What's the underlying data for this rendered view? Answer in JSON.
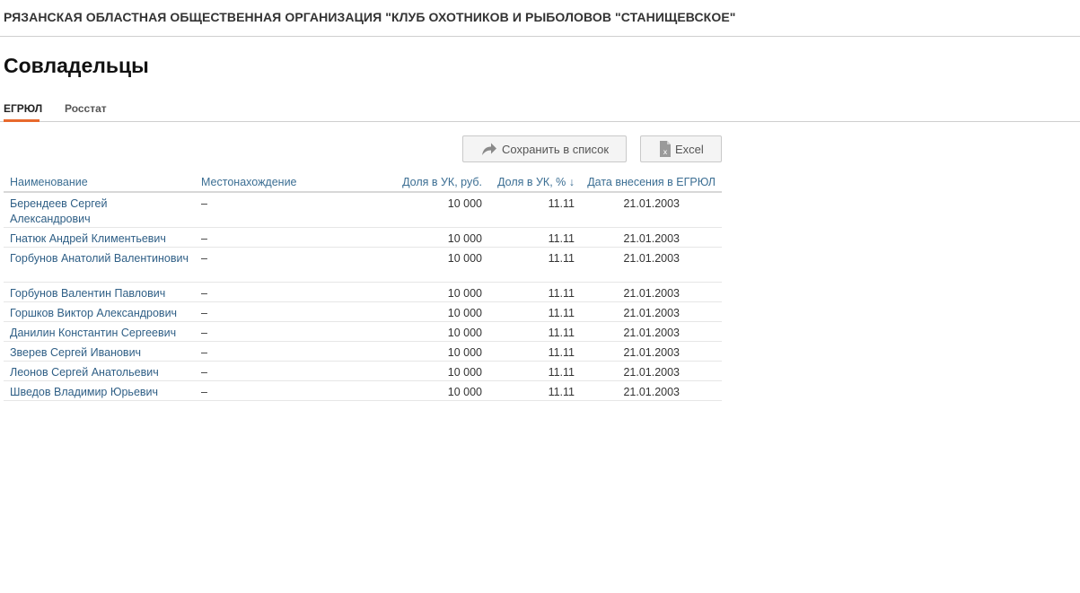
{
  "header": {
    "org_name": "РЯЗАНСКАЯ ОБЛАСТНАЯ ОБЩЕСТВЕННАЯ ОРГАНИЗАЦИЯ \"КЛУБ ОХОТНИКОВ И РЫБОЛОВОВ \"СТАНИЩЕВСКОЕ\""
  },
  "page": {
    "title": "Совладельцы"
  },
  "tabs": [
    {
      "label": "ЕГРЮЛ",
      "active": true
    },
    {
      "label": "Росстат",
      "active": false
    }
  ],
  "toolbar": {
    "save_label": "Сохранить в список",
    "save_icon": "share-arrow-icon",
    "excel_label": "Excel",
    "excel_icon": "excel-file-icon"
  },
  "colors": {
    "accent": "#e8692c",
    "link": "#2f5f86"
  },
  "table": {
    "columns": {
      "name": "Наименование",
      "location": "Местонахождение",
      "share_rub": "Доля в УК, руб.",
      "share_pct": "Доля в УК, % ↓",
      "date": "Дата внесения в ЕГРЮЛ"
    },
    "rows": [
      {
        "name": "Берендеев Сергей Александрович",
        "location": "–",
        "share_rub": "10 000",
        "share_pct": "11.11",
        "date": "21.01.2003"
      },
      {
        "name": "Гнатюк Андрей Климентьевич",
        "location": "–",
        "share_rub": "10 000",
        "share_pct": "11.11",
        "date": "21.01.2003"
      },
      {
        "name": "Горбунов Анатолий Валентинович",
        "location": "–",
        "share_rub": "10 000",
        "share_pct": "11.11",
        "date": "21.01.2003"
      },
      {
        "name": "Горбунов Валентин Павлович",
        "location": "–",
        "share_rub": "10 000",
        "share_pct": "11.11",
        "date": "21.01.2003"
      },
      {
        "name": "Горшков Виктор Александрович",
        "location": "–",
        "share_rub": "10 000",
        "share_pct": "11.11",
        "date": "21.01.2003"
      },
      {
        "name": "Данилин Константин Сергеевич",
        "location": "–",
        "share_rub": "10 000",
        "share_pct": "11.11",
        "date": "21.01.2003"
      },
      {
        "name": "Зверев Сергей Иванович",
        "location": "–",
        "share_rub": "10 000",
        "share_pct": "11.11",
        "date": "21.01.2003"
      },
      {
        "name": "Леонов Сергей Анатольевич",
        "location": "–",
        "share_rub": "10 000",
        "share_pct": "11.11",
        "date": "21.01.2003"
      },
      {
        "name": "Шведов Владимир Юрьевич",
        "location": "–",
        "share_rub": "10 000",
        "share_pct": "11.11",
        "date": "21.01.2003"
      }
    ]
  }
}
